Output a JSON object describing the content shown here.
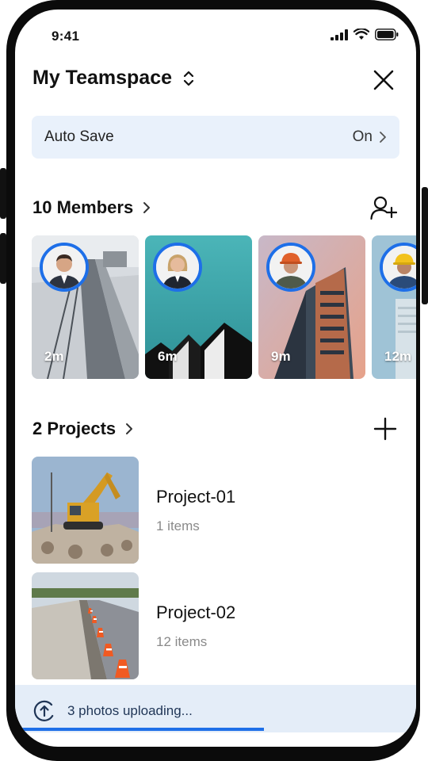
{
  "status": {
    "time": "9:41"
  },
  "header": {
    "title": "My Teamspace"
  },
  "autosave": {
    "label": "Auto Save",
    "value": "On"
  },
  "members": {
    "heading": "10 Members",
    "items": [
      {
        "time": "2m"
      },
      {
        "time": "6m"
      },
      {
        "time": "9m"
      },
      {
        "time": "12m"
      }
    ]
  },
  "projects": {
    "heading": "2 Projects",
    "items": [
      {
        "name": "Project-01",
        "count": "1 items"
      },
      {
        "name": "Project-02",
        "count": "12 items"
      }
    ]
  },
  "upload": {
    "text": "3 photos uploading...",
    "progress": 0.62
  },
  "colors": {
    "accent": "#1e6fe8",
    "autosave_bg": "#e9f1fb",
    "upload_bg": "#e4edf8"
  },
  "icons": [
    "signal-icon",
    "wifi-icon",
    "battery-icon",
    "sort-icon",
    "close-icon",
    "chevron-right-icon",
    "add-user-icon",
    "plus-icon",
    "upload-icon"
  ]
}
